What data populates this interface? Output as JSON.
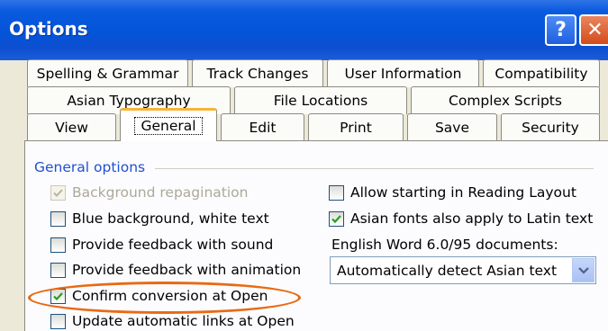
{
  "window": {
    "title": "Options",
    "help_glyph": "?",
    "close_glyph": "✕"
  },
  "tabs": {
    "row1": [
      "Spelling & Grammar",
      "Track Changes",
      "User Information",
      "Compatibility"
    ],
    "row2": [
      "Asian Typography",
      "File Locations",
      "Complex Scripts"
    ],
    "row3": [
      "View",
      "General",
      "Edit",
      "Print",
      "Save",
      "Security"
    ],
    "active": "General"
  },
  "general": {
    "group_title": "General options",
    "left_options": [
      {
        "label": "Background repagination",
        "checked": true,
        "disabled": true
      },
      {
        "label": "Blue background, white text",
        "checked": false,
        "disabled": false
      },
      {
        "label": "Provide feedback with sound",
        "checked": false,
        "disabled": false
      },
      {
        "label": "Provide feedback with animation",
        "checked": false,
        "disabled": false
      },
      {
        "label": "Confirm conversion at Open",
        "checked": true,
        "disabled": false
      },
      {
        "label": "Update automatic links at Open",
        "checked": false,
        "disabled": false
      }
    ],
    "right_options": [
      {
        "label": "Allow starting in Reading Layout",
        "checked": false
      },
      {
        "label": "Asian fonts also apply to Latin text",
        "checked": true
      }
    ],
    "english_word_label": "English Word 6.0/95 documents:",
    "english_word_value": "Automatically detect Asian text"
  },
  "colors": {
    "titlebar": "#0454d8",
    "dialog_bg": "#ece9d8",
    "group_title": "#2050d0",
    "highlight": "#e86a14",
    "check_mark": "#21a121"
  }
}
